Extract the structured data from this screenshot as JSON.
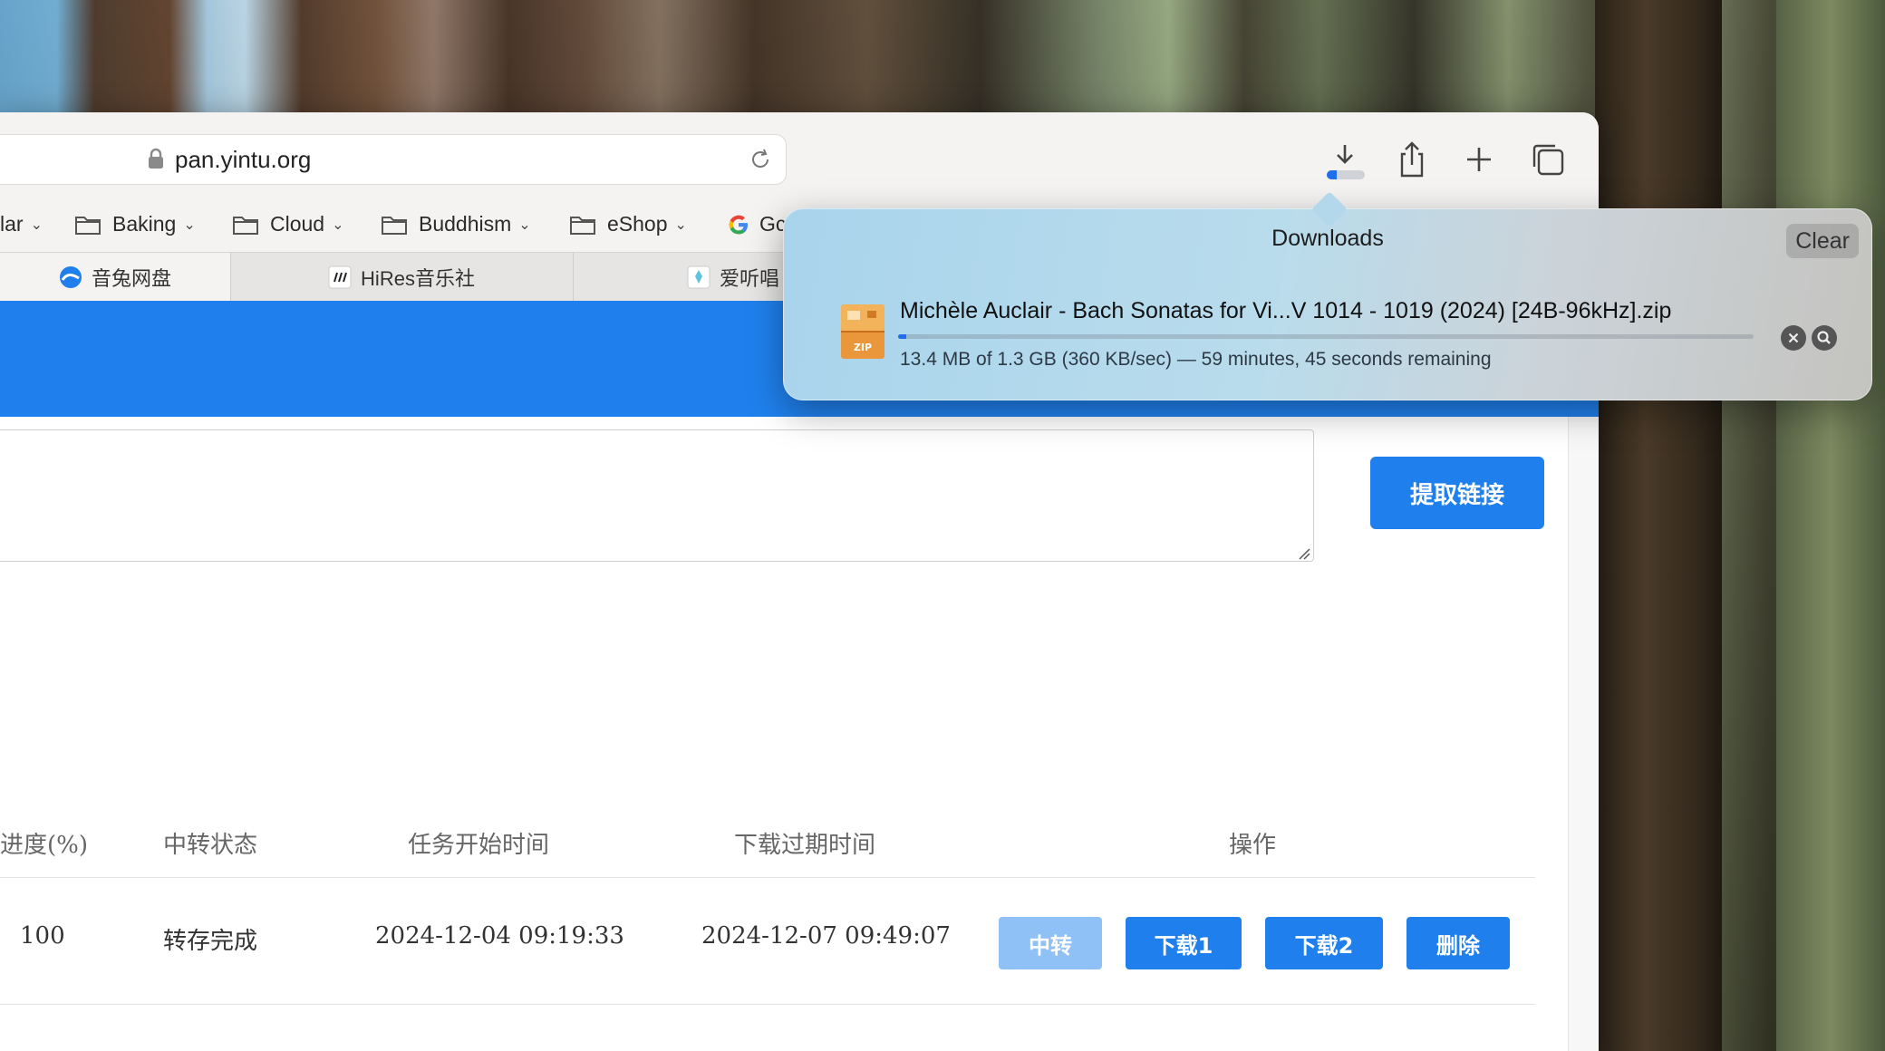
{
  "browser": {
    "url": "pan.yintu.org"
  },
  "bookmarks": [
    {
      "label": "lar",
      "has_folder": false
    },
    {
      "label": "Baking",
      "has_folder": true
    },
    {
      "label": "Cloud",
      "has_folder": true
    },
    {
      "label": "Buddhism",
      "has_folder": true
    },
    {
      "label": "eShop",
      "has_folder": true
    },
    {
      "label": "Gc",
      "has_folder": false,
      "icon": "google-icon"
    }
  ],
  "tabs": [
    {
      "label": "音兔网盘",
      "active": true
    },
    {
      "label": "HiRes音乐社",
      "active": false
    },
    {
      "label": "爱听唱",
      "active": false
    }
  ],
  "page": {
    "extract_button": "提取链接",
    "table": {
      "headers": [
        "进度(%)",
        "中转状态",
        "任务开始时间",
        "下载过期时间",
        "操作"
      ],
      "rows": [
        {
          "progress": "100",
          "status": "转存完成",
          "start_time": "2024-12-04 09:19:33",
          "expire_time": "2024-12-07 09:49:07",
          "actions": [
            "中转",
            "下载1",
            "下载2",
            "删除"
          ]
        }
      ]
    }
  },
  "downloads": {
    "title": "Downloads",
    "clear_label": "Clear",
    "items": [
      {
        "file_name": "Michèle Auclair - Bach Sonatas for Vi...V 1014 - 1019 (2024) [24B-96kHz].zip",
        "icon_label": "ZIP",
        "status": "13.4 MB of 1.3 GB (360 KB/sec) — 59 minutes, 45 seconds remaining",
        "progress_fraction": 0.01
      }
    ],
    "toolbar_progress_fraction": 0.25
  },
  "colors": {
    "accent": "#1f80ed",
    "accent_disabled": "#8fc0f6",
    "download_progress": "#1f6fea"
  }
}
